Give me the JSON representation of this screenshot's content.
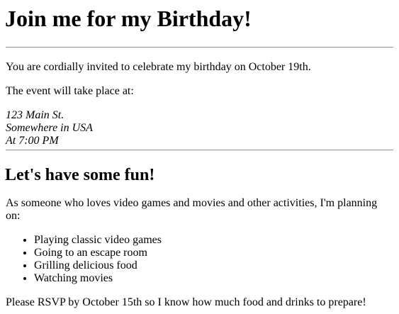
{
  "title": "Join me for my Birthday!",
  "intro": "You are cordially invited to celebrate my birthday on October 19th.",
  "location_lead": "The event will take place at:",
  "address": {
    "line1": "123 Main St.",
    "line2": "Somewhere in USA",
    "time": "At 7:00 PM"
  },
  "fun_heading": "Let's have some fun!",
  "activities_lead": "As someone who loves video games and movies and other activities, I'm planning on:",
  "activities": [
    "Playing classic video games",
    "Going to an escape room",
    "Grilling delicious food",
    "Watching movies"
  ],
  "rsvp": "Please RSVP by October 15th so I know how much food and drinks to prepare!"
}
